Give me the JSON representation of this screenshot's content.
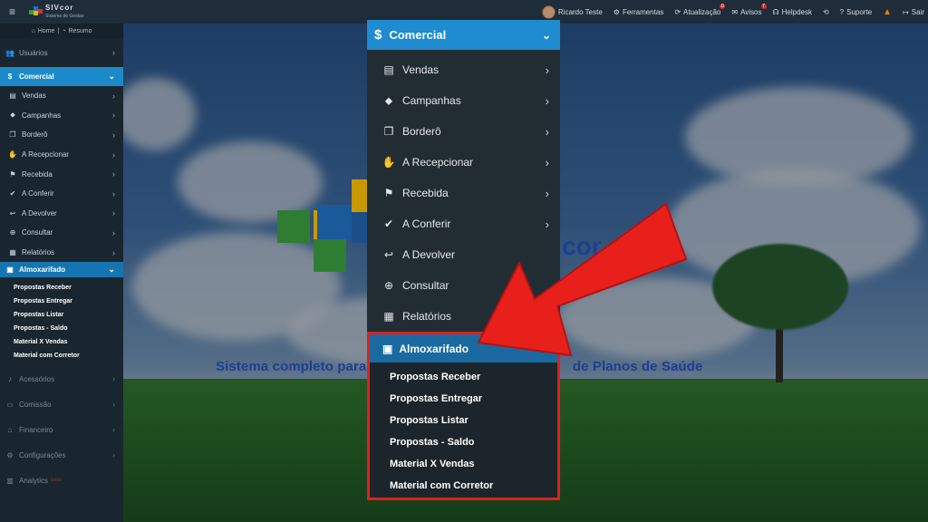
{
  "topbar": {
    "brand_name": "SIVcor",
    "brand_sub": "Sistema de Gestao",
    "user": "Ricardo Teste",
    "items": [
      {
        "label": "Ferramentas",
        "icon": "gears-icon"
      },
      {
        "label": "Atualização",
        "icon": "refresh-icon",
        "badge": "0"
      },
      {
        "label": "Avisos",
        "icon": "chat-icon",
        "badge": "7"
      },
      {
        "label": "Helpdesk",
        "icon": "headset-icon"
      },
      {
        "label": "Suporte",
        "icon": "question-icon"
      },
      {
        "label": "Sair",
        "icon": "logout-icon"
      }
    ]
  },
  "sidebar": {
    "home": "Home",
    "resumo": "Resumo",
    "usuarios": "Usuários",
    "comercial": "Comercial",
    "items": [
      {
        "label": "Vendas",
        "icon": "briefcase-icon"
      },
      {
        "label": "Campanhas",
        "icon": "tag-icon"
      },
      {
        "label": "Borderô",
        "icon": "copy-icon"
      },
      {
        "label": "A Recepcionar",
        "icon": "handshake-icon"
      },
      {
        "label": "Recebida",
        "icon": "bookmark-icon"
      },
      {
        "label": "A Conferir",
        "icon": "check-circle-icon"
      },
      {
        "label": "A Devolver",
        "icon": "return-icon"
      },
      {
        "label": "Consultar",
        "icon": "binoculars-icon"
      },
      {
        "label": "Relatórios",
        "icon": "report-icon"
      }
    ],
    "almoxarifado": "Almoxarifado",
    "almox_items": [
      "Propostas Receber",
      "Propostas Entregar",
      "Propostas Listar",
      "Propostas - Saldo",
      "Material X Vendas",
      "Material com Corretor"
    ],
    "bottom": [
      {
        "label": "Acessórios",
        "icon": "bell-icon"
      },
      {
        "label": "Comissão",
        "icon": "money-icon"
      },
      {
        "label": "Financeiro",
        "icon": "bank-icon"
      },
      {
        "label": "Configurações",
        "icon": "gears-icon"
      },
      {
        "label": "Analytics",
        "icon": "chart-icon",
        "badge": "beta"
      }
    ]
  },
  "menu": {
    "title": "Comercial",
    "items": [
      {
        "label": "Vendas",
        "icon": "briefcase-icon"
      },
      {
        "label": "Campanhas",
        "icon": "tag-icon"
      },
      {
        "label": "Borderô",
        "icon": "copy-icon"
      },
      {
        "label": "A Recepcionar",
        "icon": "handshake-icon"
      },
      {
        "label": "Recebida",
        "icon": "bookmark-icon"
      },
      {
        "label": "A Conferir",
        "icon": "check-circle-icon"
      },
      {
        "label": "A Devolver",
        "icon": "return-icon"
      },
      {
        "label": "Consultar",
        "icon": "binoculars-icon"
      },
      {
        "label": "Relatórios",
        "icon": "report-icon"
      }
    ],
    "almoxarifado": "Almoxarifado",
    "almox_items": [
      "Propostas Receber",
      "Propostas Entregar",
      "Propostas Listar",
      "Propostas - Saldo",
      "Material X Vendas",
      "Material com Corretor"
    ]
  },
  "background": {
    "tagline_left": "Sistema completo para",
    "tagline_right": "de Planos de Saúde",
    "logo_fragment": "cor"
  },
  "colors": {
    "accent": "#1f8bd0",
    "highlight_border": "#e0201b",
    "arrow": "#e8201c"
  }
}
